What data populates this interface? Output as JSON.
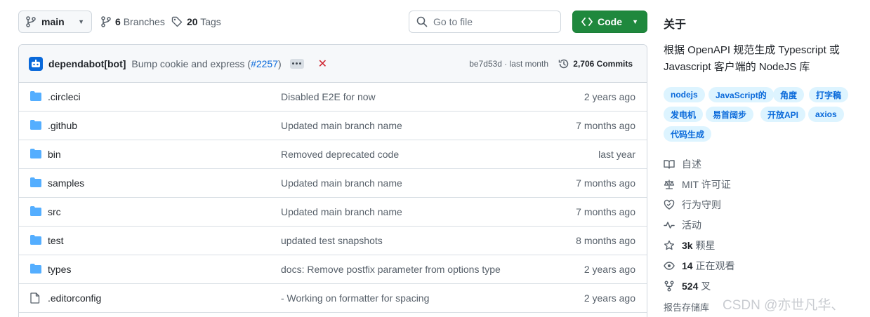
{
  "toolbar": {
    "branch": "main",
    "branches_count": "6",
    "branches_label": "Branches",
    "tags_count": "20",
    "tags_label": "Tags",
    "goto_placeholder": "Go to file",
    "code_label": "Code"
  },
  "commit": {
    "author": "dependabot[bot]",
    "message": "Bump cookie and express (",
    "pr": "#2257",
    "message_end": ")",
    "hash_time": "be7d53d · last month",
    "commits_count": "2,706 Commits"
  },
  "files": [
    {
      "type": "folder",
      "name": ".circleci",
      "message": "Disabled E2E for now",
      "date": "2 years ago"
    },
    {
      "type": "folder",
      "name": ".github",
      "message": "Updated main branch name",
      "date": "7 months ago"
    },
    {
      "type": "folder",
      "name": "bin",
      "message": "Removed deprecated code",
      "date": "last year"
    },
    {
      "type": "folder",
      "name": "samples",
      "message": "Updated main branch name",
      "date": "7 months ago"
    },
    {
      "type": "folder",
      "name": "src",
      "message": "Updated main branch name",
      "date": "7 months ago"
    },
    {
      "type": "folder",
      "name": "test",
      "message": "updated test snapshots",
      "date": "8 months ago"
    },
    {
      "type": "folder",
      "name": "types",
      "message": "docs: Remove postfix parameter from options type",
      "date": "2 years ago"
    },
    {
      "type": "file",
      "name": ".editorconfig",
      "message": "- Working on formatter for spacing",
      "date": "2 years ago"
    }
  ],
  "about": {
    "title": "关于",
    "description": "根据 OpenAPI 规范生成 Typescript 或 Javascript 客户端的 NodeJS 库",
    "topics": [
      "nodejs",
      "JavaScript的",
      "角度",
      "打字稿",
      "发电机",
      "易首阔步",
      "开放API",
      "axios",
      "代码生成"
    ],
    "readme": "自述",
    "license": "MIT 许可证",
    "conduct": "行为守则",
    "activity": "活动",
    "stars_count": "3k",
    "stars_label": "颗星",
    "watching_count": "14",
    "watching_label": "正在观看",
    "forks_count": "524",
    "forks_label": "叉",
    "report": "报告存储库"
  },
  "watermark": "CSDN @亦世凡华、",
  "colors": {
    "accent_green": "#1f883d",
    "link_blue": "#0969da",
    "folder_blue": "#54aeff",
    "topic_bg": "#ddf4ff",
    "fail_red": "#cf222e"
  }
}
